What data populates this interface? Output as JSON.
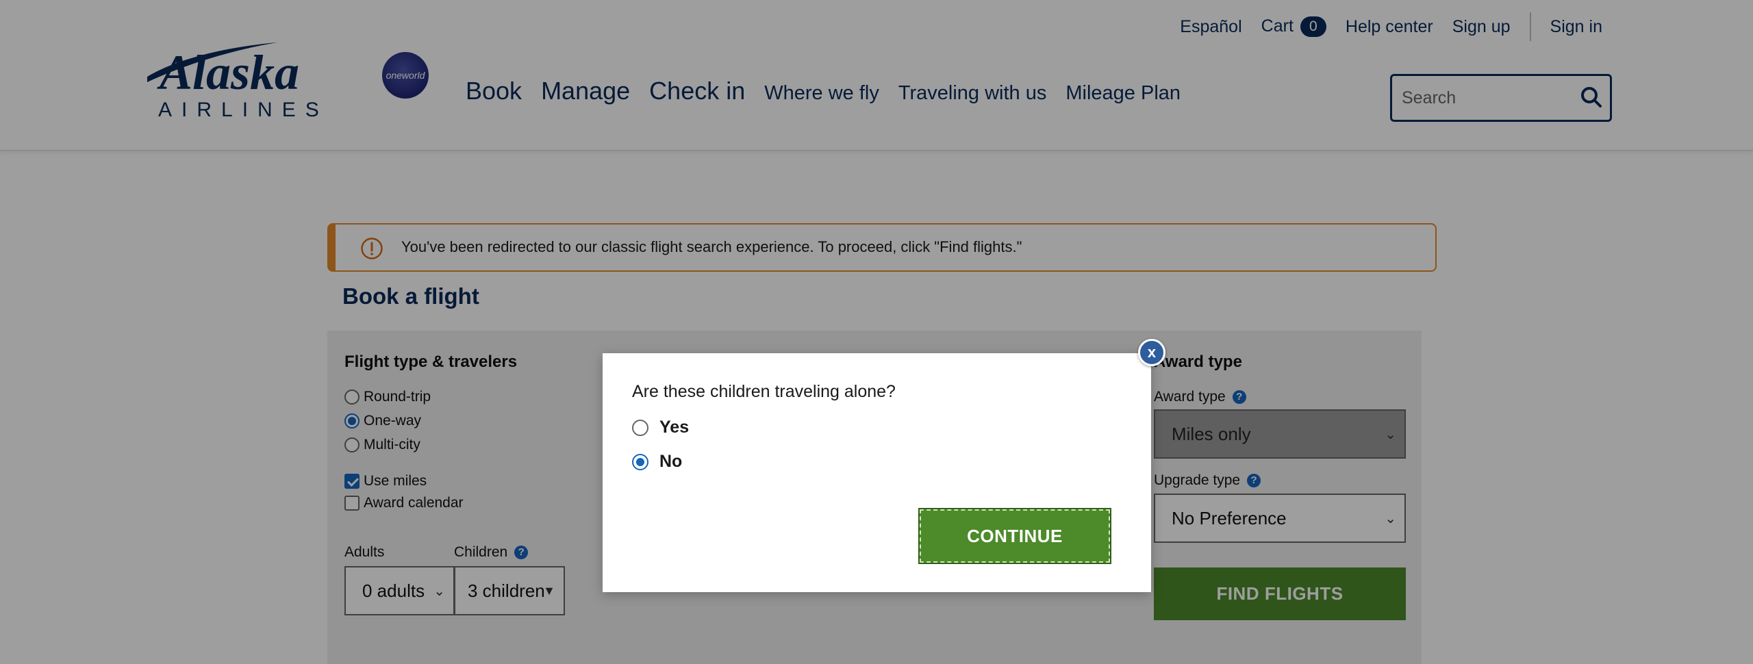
{
  "header": {
    "brand_logo_text": "Alaska",
    "brand_logo_subtext": "AIRLINES",
    "alliance_badge": "oneworld",
    "nav": {
      "book": "Book",
      "manage": "Manage",
      "check_in": "Check in",
      "where_we_fly": "Where we fly",
      "traveling_with_us": "Traveling with us",
      "mileage_plan": "Mileage Plan"
    },
    "utility": {
      "espanol": "Español",
      "cart": "Cart",
      "cart_count": "0",
      "help_center": "Help center",
      "sign_up": "Sign up",
      "sign_in": "Sign in"
    },
    "search": {
      "placeholder": "Search",
      "value": ""
    }
  },
  "alert": {
    "message": "You've been redirected to our classic flight search experience. To proceed, click \"Find flights.\""
  },
  "page_title": "Book a flight",
  "booking_form": {
    "flight_type_heading": "Flight type & travelers",
    "trip_types": [
      {
        "label": "Round-trip",
        "selected": false
      },
      {
        "label": "One-way",
        "selected": true
      },
      {
        "label": "Multi-city",
        "selected": false
      }
    ],
    "use_miles": {
      "label": "Use miles",
      "checked": true
    },
    "award_calendar": {
      "label": "Award calendar",
      "checked": false
    },
    "adults": {
      "label": "Adults",
      "value": "0 adults"
    },
    "children": {
      "label": "Children",
      "value": "3 children"
    },
    "award_type_heading": "Award type",
    "award_type": {
      "label": "Award type",
      "value": "Miles only"
    },
    "upgrade_type": {
      "label": "Upgrade type",
      "value": "No Preference"
    },
    "find_flights": "FIND FLIGHTS"
  },
  "modal": {
    "close_label": "x",
    "question": "Are these children traveling alone?",
    "options": [
      {
        "label": "Yes",
        "selected": false
      },
      {
        "label": "No",
        "selected": true
      }
    ],
    "continue": "CONTINUE"
  },
  "colors": {
    "brand_navy": "#0a2a5a",
    "action_green": "#4d8a2a",
    "alert_orange": "#e48a2a",
    "radio_blue": "#1565c0"
  }
}
